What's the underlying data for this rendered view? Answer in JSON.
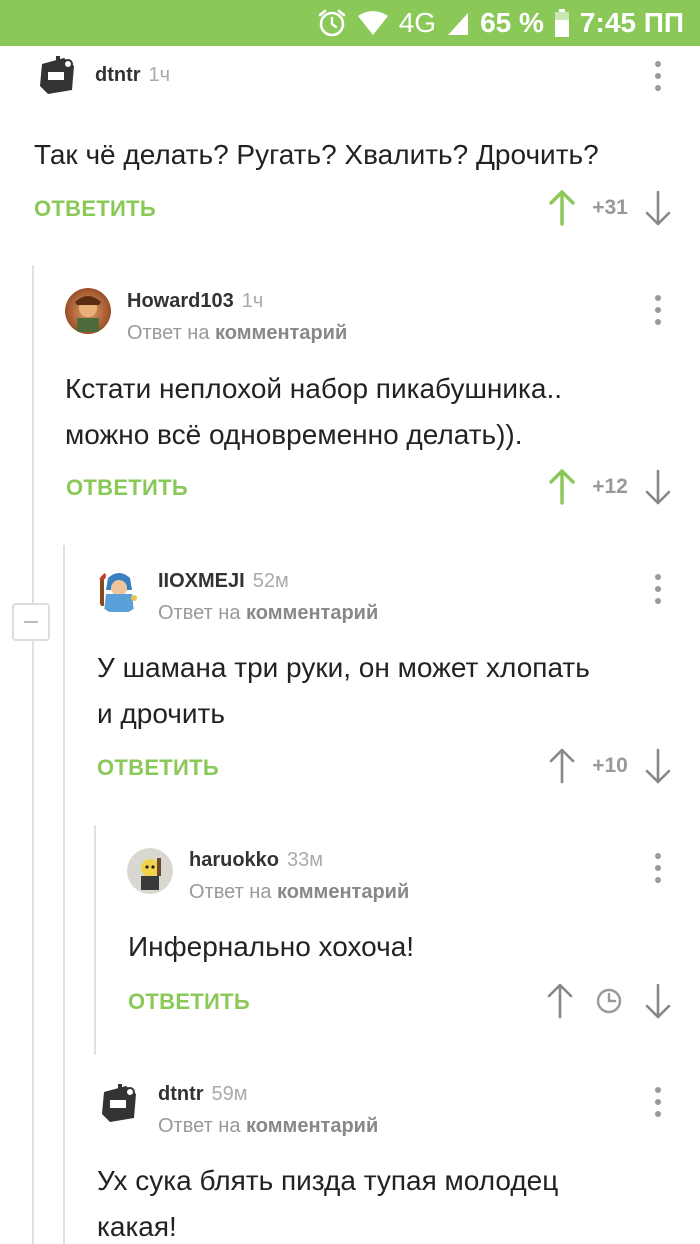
{
  "status_bar": {
    "network": "4G",
    "battery": "65 %",
    "time": "7:45 ПП",
    "bg_color": "#8ac858"
  },
  "accent_color": "#8ac858",
  "comments": [
    {
      "username": "dtntr",
      "time": "1ч",
      "reply_prefix": "",
      "reply_target": "",
      "text": "Так чё делать? Ругать? Хвалить? Дрочить?",
      "reply_label": "ОТВЕТИТЬ",
      "rating": "+31",
      "voted_up": true,
      "avatar_icon": "robot-avatar"
    },
    {
      "username": "Howard103",
      "time": "1ч",
      "reply_prefix": "Ответ на",
      "reply_target": "комментарий",
      "text_lines": [
        "Кстати неплохой набор пикабушника..",
        "можно всё одновременно делать))."
      ],
      "reply_label": "ОТВЕТИТЬ",
      "rating": "+12",
      "voted_up": true,
      "avatar_icon": "character-avatar"
    },
    {
      "username": "IIOXMEJI",
      "time": "52м",
      "reply_prefix": "Ответ на",
      "reply_target": "комментарий",
      "text_lines": [
        "У шамана три руки, он может хлопать",
        "и дрочить"
      ],
      "reply_label": "ОТВЕТИТЬ",
      "rating": "+10",
      "voted_up": false,
      "avatar_icon": "shaman-avatar"
    },
    {
      "username": "haruokko",
      "time": "33м",
      "reply_prefix": "Ответ на",
      "reply_target": "комментарий",
      "text": "Инфернально хохоча!",
      "reply_label": "ОТВЕТИТЬ",
      "rating": "",
      "voted_up": false,
      "avatar_icon": "cartoon-avatar"
    },
    {
      "username": "dtntr",
      "time": "59м",
      "reply_prefix": "Ответ на",
      "reply_target": "комментарий",
      "text_lines": [
        "Ух сука блять пизда тупая молодец",
        "какая!"
      ],
      "avatar_icon": "robot-avatar"
    }
  ]
}
